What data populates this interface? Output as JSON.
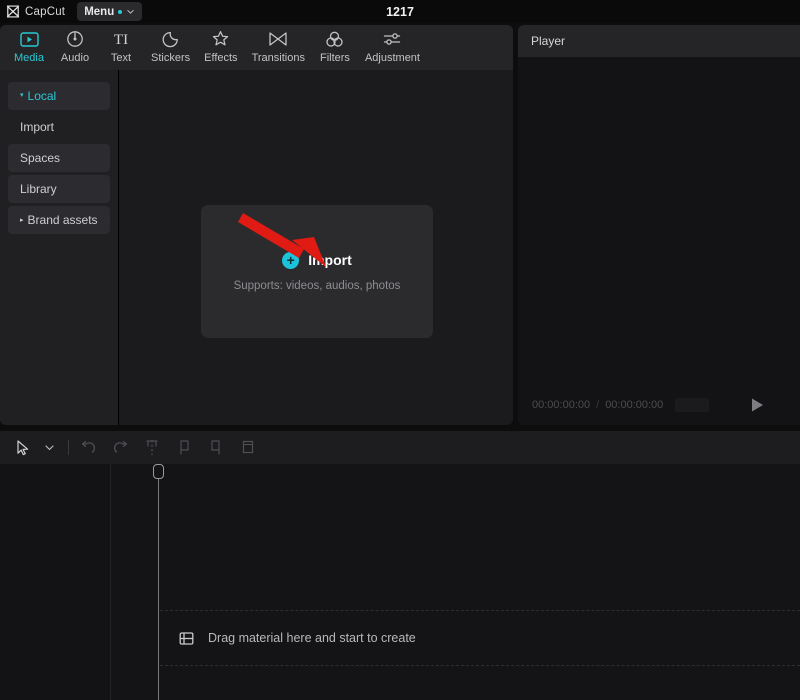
{
  "titlebar": {
    "brand": "CapCut",
    "brand_logo_icon": "capcut-logo-icon",
    "menu_label": "Menu",
    "menu_badge_icon": "notification-dot-icon",
    "menu_chevron_icon": "chevron-down-icon",
    "project_title": "1217"
  },
  "media_panel": {
    "tabs": [
      {
        "label": "Media",
        "icon": "media-play-frame-icon",
        "active": true
      },
      {
        "label": "Audio",
        "icon": "audio-note-icon",
        "active": false
      },
      {
        "label": "Text",
        "icon": "text-ti-icon",
        "active": false
      },
      {
        "label": "Stickers",
        "icon": "sticker-moon-icon",
        "active": false
      },
      {
        "label": "Effects",
        "icon": "effects-sparkle-icon",
        "active": false
      },
      {
        "label": "Transitions",
        "icon": "transitions-bowtie-icon",
        "active": false
      },
      {
        "label": "Filters",
        "icon": "filters-circles-icon",
        "active": false
      },
      {
        "label": "Adjustment",
        "icon": "adjustment-sliders-icon",
        "active": false
      }
    ],
    "sidebar": [
      {
        "label": "Local",
        "state": "expanded",
        "accent": true,
        "filled": true
      },
      {
        "label": "Import",
        "state": "plain",
        "accent": false,
        "filled": false
      },
      {
        "label": "Spaces",
        "state": "plain",
        "accent": false,
        "filled": true
      },
      {
        "label": "Library",
        "state": "plain",
        "accent": false,
        "filled": true
      },
      {
        "label": "Brand assets",
        "state": "collapsed",
        "accent": false,
        "filled": true
      }
    ],
    "import_card": {
      "plus_icon": "plus-circle-icon",
      "title": "Import",
      "subtitle": "Supports: videos, audios, photos"
    },
    "annotation": {
      "icon": "red-arrow-annotation",
      "color": "#e01b14"
    }
  },
  "player": {
    "title": "Player",
    "current_time": "00:00:00:00",
    "separator": "/",
    "total_time": "00:00:00:00",
    "ratio_label": "",
    "play_icon": "play-triangle-icon"
  },
  "timeline": {
    "tools": [
      {
        "name": "select-arrow-tool",
        "icon": "cursor-arrow-icon",
        "enabled": true
      },
      {
        "name": "tool-dropdown",
        "icon": "chevron-down-icon",
        "enabled": true
      },
      {
        "name": "undo-tool",
        "icon": "undo-arrow-icon",
        "enabled": false
      },
      {
        "name": "redo-tool",
        "icon": "redo-arrow-icon",
        "enabled": false
      },
      {
        "name": "split-tool",
        "icon": "split-scissors-icon",
        "enabled": false
      },
      {
        "name": "delete-left-tool",
        "icon": "trim-left-icon",
        "enabled": false
      },
      {
        "name": "delete-right-tool",
        "icon": "trim-right-icon",
        "enabled": false
      },
      {
        "name": "crop-tool",
        "icon": "crop-frame-icon",
        "enabled": false
      }
    ],
    "dropzone": {
      "icon": "media-stack-icon",
      "text": "Drag material here and start to create"
    }
  },
  "colors": {
    "accent": "#2ac9d4",
    "annotation_red": "#e01b14",
    "panel_bg": "#1c1c1e",
    "window_bg": "#0d0d0d"
  }
}
